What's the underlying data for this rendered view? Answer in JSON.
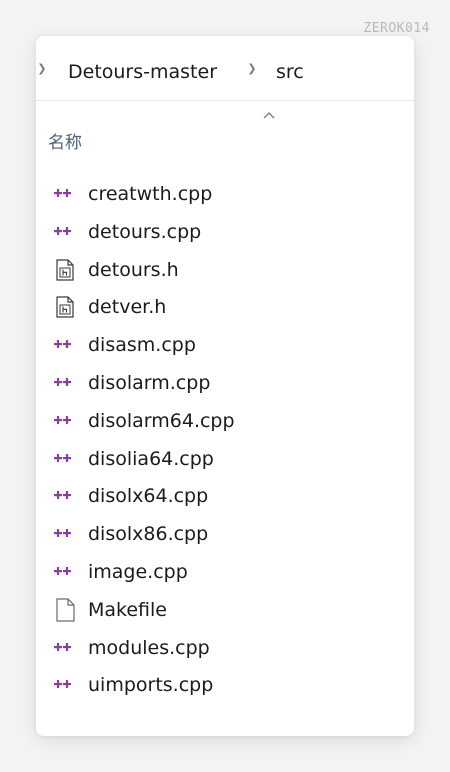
{
  "watermark": "ZEROK014",
  "breadcrumb": {
    "items": [
      "Detours-master",
      "src"
    ]
  },
  "column_header": {
    "name_label": "名称"
  },
  "files": [
    {
      "name": "creatwth.cpp",
      "icon": "cpp-file-icon"
    },
    {
      "name": "detours.cpp",
      "icon": "cpp-file-icon"
    },
    {
      "name": "detours.h",
      "icon": "header-file-icon"
    },
    {
      "name": "detver.h",
      "icon": "header-file-icon"
    },
    {
      "name": "disasm.cpp",
      "icon": "cpp-file-icon"
    },
    {
      "name": "disolarm.cpp",
      "icon": "cpp-file-icon"
    },
    {
      "name": "disolarm64.cpp",
      "icon": "cpp-file-icon"
    },
    {
      "name": "disolia64.cpp",
      "icon": "cpp-file-icon"
    },
    {
      "name": "disolx64.cpp",
      "icon": "cpp-file-icon"
    },
    {
      "name": "disolx86.cpp",
      "icon": "cpp-file-icon"
    },
    {
      "name": "image.cpp",
      "icon": "cpp-file-icon"
    },
    {
      "name": "Makefile",
      "icon": "blank-file-icon"
    },
    {
      "name": "modules.cpp",
      "icon": "cpp-file-icon"
    },
    {
      "name": "uimports.cpp",
      "icon": "cpp-file-icon"
    }
  ],
  "colors": {
    "cpp_icon": "#8a3f9a",
    "text": "#1b1b1b",
    "header_text": "#4c607a"
  }
}
